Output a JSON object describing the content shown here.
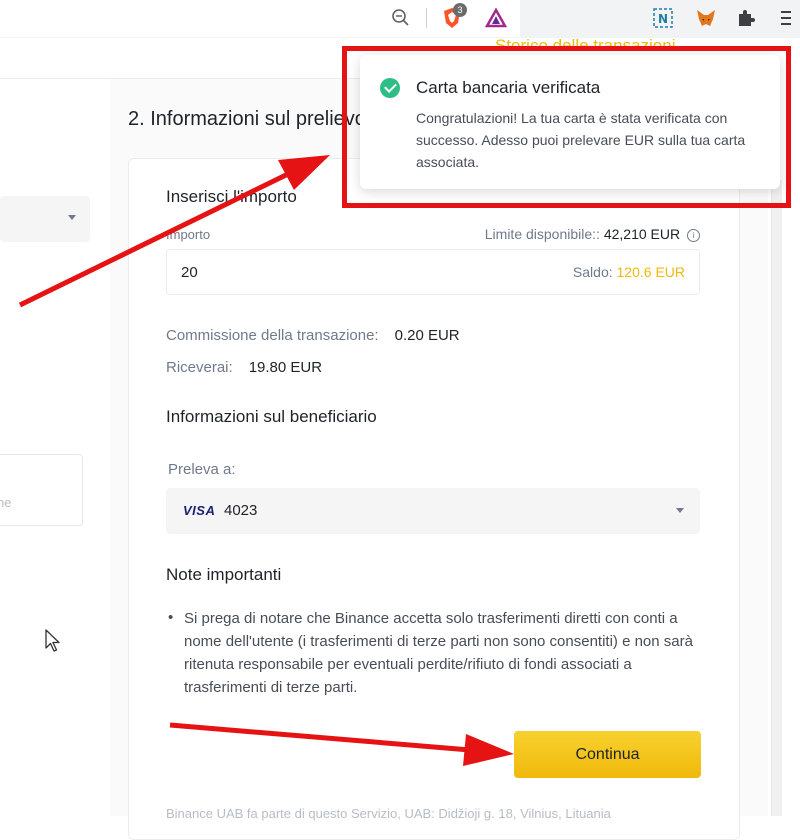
{
  "browser": {
    "badge_count": "3"
  },
  "page": {
    "history_link": "Storico delle transazioni",
    "section_title": "2. Informazioni sul prelievo",
    "left_box_text": "ne"
  },
  "form": {
    "amount_title": "Inserisci l'importo",
    "amount_label": "Importo",
    "limit_label": "Limite disponibile::",
    "limit_value": "42,210 EUR",
    "amount_value": "20",
    "balance_label": "Saldo:",
    "balance_value": "120.6 EUR",
    "fee_label": "Commissione della transazione:",
    "fee_value": "0.20 EUR",
    "receive_label": "Riceverai:",
    "receive_value": "19.80 EUR",
    "beneficiary_title": "Informazioni sul beneficiario",
    "withdraw_to_label": "Preleva a:",
    "card_brand": "VISA",
    "card_number": "4023",
    "notes_title": "Note importanti",
    "notes_text": "Si prega di notare che Binance accetta solo trasferimenti diretti con conti a nome dell'utente (i trasferimenti di terze parti non sono consentiti) e non sarà ritenuta responsabile per eventuali perdite/rifiuto di fondi associati a trasferimenti di terze parti.",
    "continue_label": "Continua",
    "footer_note": "Binance UAB fa parte di questo Servizio, UAB: Didžioji g. 18, Vilnius, Lituania"
  },
  "toast": {
    "title": "Carta bancaria verificata",
    "body": "Congratulazioni! La tua carta è stata verificata con successo. Adesso puoi prelevare EUR sulla tua carta associata."
  },
  "colors": {
    "accent": "#f0b90b",
    "success": "#2ebd85",
    "annotation": "#e51313"
  },
  "icons": [
    "zoom-icon",
    "brave-shield-icon",
    "triangle-rewards-icon",
    "notion-extension-icon",
    "metamask-fox-icon",
    "puzzle-extensions-icon",
    "menu-icon",
    "info-icon",
    "check-icon",
    "caret-down-icon",
    "cursor-icon"
  ]
}
